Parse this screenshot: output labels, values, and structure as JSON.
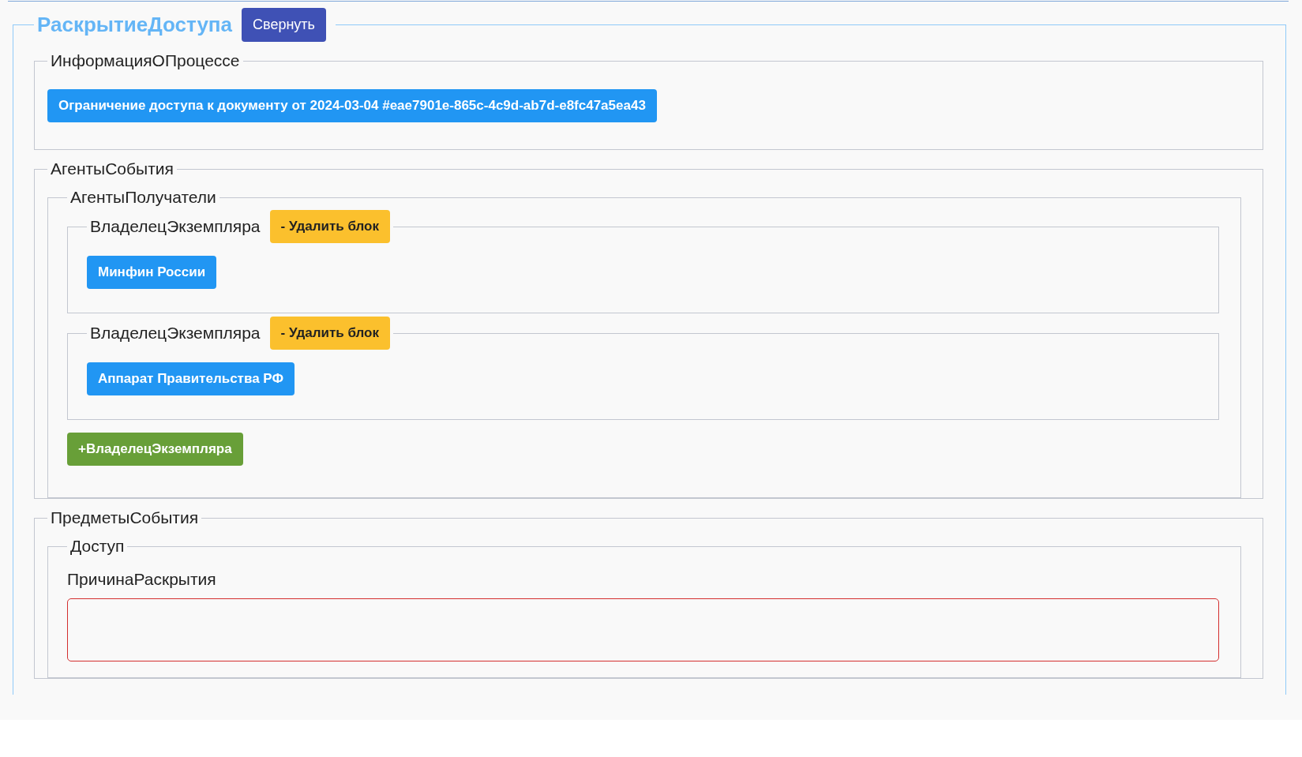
{
  "section": {
    "title": "РаскрытиеДоступа",
    "collapse_button": "Свернуть",
    "process_info": {
      "legend": "ИнформацияОПроцессе",
      "process_button": "Ограничение доступа к документу от 2024-03-04 #eae7901e-865c-4c9d-ab7d-e8fc47a5ea43"
    },
    "event_agents": {
      "legend": "АгентыСобытия",
      "recipients": {
        "legend": "АгентыПолучатели",
        "owners": [
          {
            "legend": "ВладелецЭкземпляра",
            "delete_button": "- Удалить блок",
            "value": "Минфин России"
          },
          {
            "legend": "ВладелецЭкземпляра",
            "delete_button": "- Удалить блок",
            "value": "Аппарат Правительства РФ"
          }
        ],
        "add_button": "+ВладелецЭкземпляра"
      }
    },
    "event_subjects": {
      "legend": "ПредметыСобытия",
      "access": {
        "legend": "Доступ",
        "field_label": "ПричинаРаскрытия",
        "invalid": true
      }
    }
  }
}
